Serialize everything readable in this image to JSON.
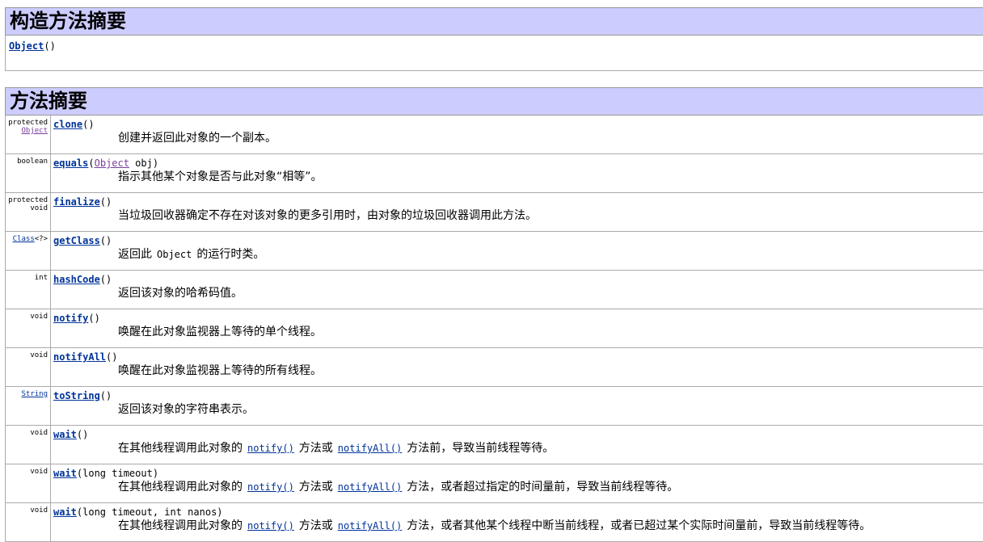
{
  "constructor_summary": {
    "heading": "构造方法摘要",
    "name": "Object",
    "params": "()"
  },
  "method_summary": {
    "heading": "方法摘要",
    "methods": [
      {
        "mod1": "protected",
        "mod2": "Object",
        "mod2_link": true,
        "name": "clone",
        "params_before": "()",
        "param_type": "",
        "params_after": "",
        "desc_parts": [
          "创建并返回此对象的一个副本。"
        ]
      },
      {
        "mod1": "boolean",
        "mod2": "",
        "mod2_link": false,
        "name": "equals",
        "params_before": "(",
        "param_type": "Object",
        "params_after": " obj)",
        "desc_parts": [
          "指示其他某个对象是否与此对象“相等”。"
        ]
      },
      {
        "mod1": "protected",
        "mod2": "void",
        "mod2_link": false,
        "name": "finalize",
        "params_before": "()",
        "param_type": "",
        "params_after": "",
        "desc_parts": [
          "当垃圾回收器确定不存在对该对象的更多引用时，由对象的垃圾回收器调用此方法。"
        ]
      },
      {
        "mod1": "Class<?>",
        "mod2": "",
        "mod2_link": false,
        "name": "getClass",
        "params_before": "()",
        "param_type": "",
        "params_after": "",
        "desc_parts": [
          "返回此 ",
          "Object",
          " 的运行时类。"
        ]
      },
      {
        "mod1": "int",
        "mod2": "",
        "mod2_link": false,
        "name": "hashCode",
        "params_before": "()",
        "param_type": "",
        "params_after": "",
        "desc_parts": [
          "返回该对象的哈希码值。"
        ]
      },
      {
        "mod1": "void",
        "mod2": "",
        "mod2_link": false,
        "name": "notify",
        "params_before": "()",
        "param_type": "",
        "params_after": "",
        "desc_parts": [
          "唤醒在此对象监视器上等待的单个线程。"
        ]
      },
      {
        "mod1": "void",
        "mod2": "",
        "mod2_link": false,
        "name": "notifyAll",
        "params_before": "()",
        "param_type": "",
        "params_after": "",
        "desc_parts": [
          "唤醒在此对象监视器上等待的所有线程。"
        ]
      },
      {
        "mod1": "String",
        "mod2": "",
        "mod2_link": false,
        "name": "toString",
        "params_before": "()",
        "param_type": "",
        "params_after": "",
        "desc_parts": [
          "返回该对象的字符串表示。"
        ]
      },
      {
        "mod1": "void",
        "mod2": "",
        "mod2_link": false,
        "name": "wait",
        "params_before": "()",
        "param_type": "",
        "params_after": "",
        "desc_parts": [
          "在其他线程调用此对象的 ",
          "notify()",
          " 方法或 ",
          "notifyAll()",
          " 方法前，导致当前线程等待。"
        ]
      },
      {
        "mod1": "void",
        "mod2": "",
        "mod2_link": false,
        "name": "wait",
        "params_before": "(long timeout)",
        "param_type": "",
        "params_after": "",
        "desc_parts": [
          "在其他线程调用此对象的 ",
          "notify()",
          " 方法或 ",
          "notifyAll()",
          " 方法，或者超过指定的时间量前，导致当前线程等待。"
        ]
      },
      {
        "mod1": "void",
        "mod2": "",
        "mod2_link": false,
        "name": "wait",
        "params_before": "(long timeout,  int nanos)",
        "param_type": "",
        "params_after": "",
        "desc_parts": [
          "在其他线程调用此对象的 ",
          "notify()",
          " 方法或 ",
          "notifyAll()",
          " 方法，或者其他某个线程中断当前线程，或者已超过某个实际时间量前，导致当前线程等待。"
        ]
      }
    ]
  },
  "colors": {
    "header_bg": "#ccccff",
    "link": "#003399",
    "type_link": "#7a3f9b"
  }
}
